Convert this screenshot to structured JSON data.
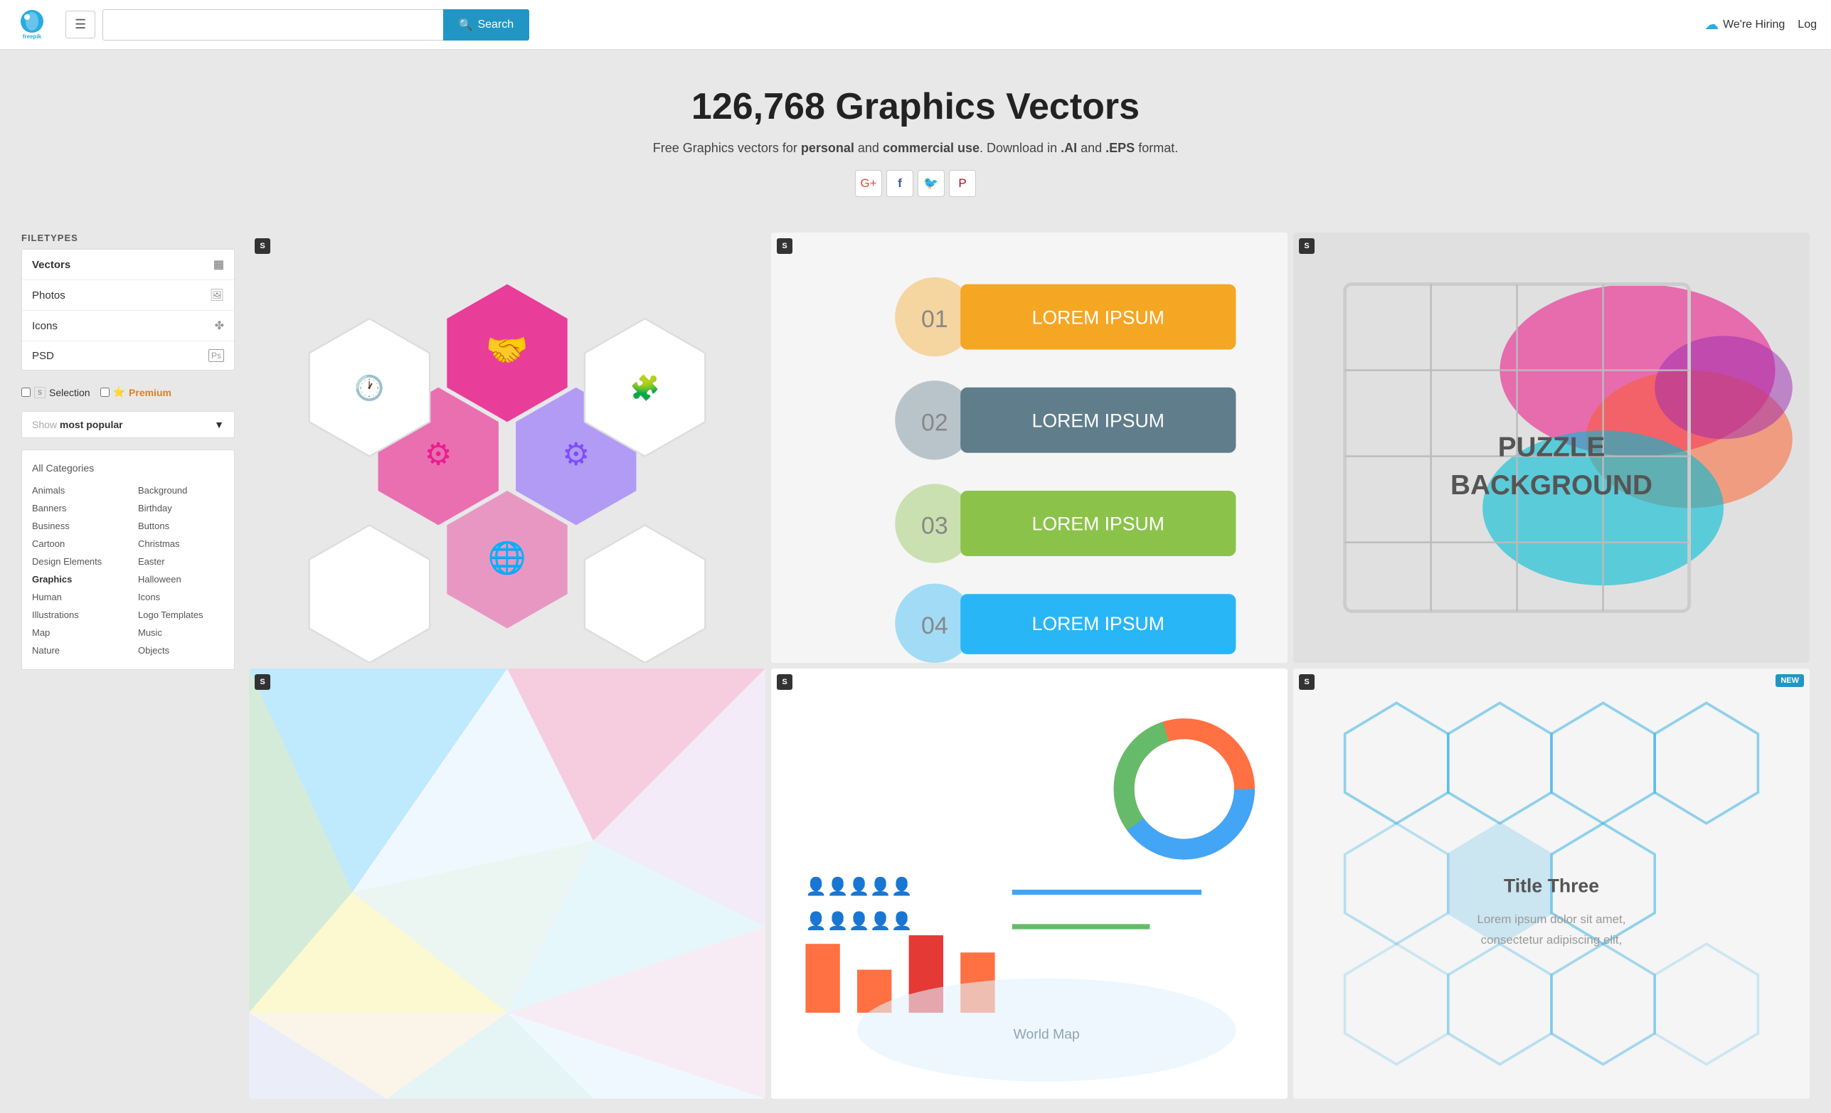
{
  "header": {
    "logo_alt": "Freepik",
    "hamburger_icon": "☰",
    "search_placeholder": "",
    "search_button_label": "Search",
    "hiring_label": "We're Hiring",
    "login_label": "Log"
  },
  "hero": {
    "title": "126,768 Graphics Vectors",
    "subtitle_prefix": "Free Graphics vectors for ",
    "subtitle_personal": "personal",
    "subtitle_mid": " and ",
    "subtitle_commercial": "commercial use",
    "subtitle_suffix": ". Download in ",
    "subtitle_ai": ".AI",
    "subtitle_and": " and ",
    "subtitle_eps": ".EPS",
    "subtitle_end": " format.",
    "social": {
      "gplus": "G+",
      "facebook": "f",
      "twitter": "🐦",
      "pinterest": "P"
    }
  },
  "sidebar": {
    "filetypes_label": "FILETYPES",
    "filetypes": [
      {
        "label": "Vectors",
        "icon": "▦",
        "active": true
      },
      {
        "label": "Photos",
        "icon": "🖼",
        "active": false
      },
      {
        "label": "Icons",
        "icon": "✤",
        "active": false
      },
      {
        "label": "PSD",
        "icon": "Ps",
        "active": false
      }
    ],
    "selection_label": "Selection",
    "premium_label": "Premium",
    "show_label": "Show",
    "most_popular_label": "most popular",
    "dropdown_arrow": "▼",
    "all_categories_label": "All Categories",
    "categories_col1": [
      "Animals",
      "Banners",
      "Business",
      "Cartoon",
      "Design Elements",
      "Graphics",
      "Human",
      "Illustrations",
      "Map",
      "Nature"
    ],
    "categories_col2": [
      "Background",
      "Birthday",
      "Buttons",
      "Christmas",
      "Easter",
      "Halloween",
      "Icons",
      "Logo Templates",
      "Music",
      "Objects"
    ]
  },
  "images": [
    {
      "id": 1,
      "badge": "S",
      "new": false,
      "alt": "Hexagon infographic design"
    },
    {
      "id": 2,
      "badge": "S",
      "new": false,
      "alt": "Ribbon step infographic"
    },
    {
      "id": 3,
      "badge": "S",
      "new": false,
      "alt": "Puzzle background"
    },
    {
      "id": 4,
      "badge": "S",
      "new": false,
      "alt": "Colorful polygon background"
    },
    {
      "id": 5,
      "badge": "S",
      "new": false,
      "alt": "Statistics infographic"
    },
    {
      "id": 6,
      "badge": "S",
      "new": true,
      "alt": "Hexagon technology background"
    }
  ]
}
